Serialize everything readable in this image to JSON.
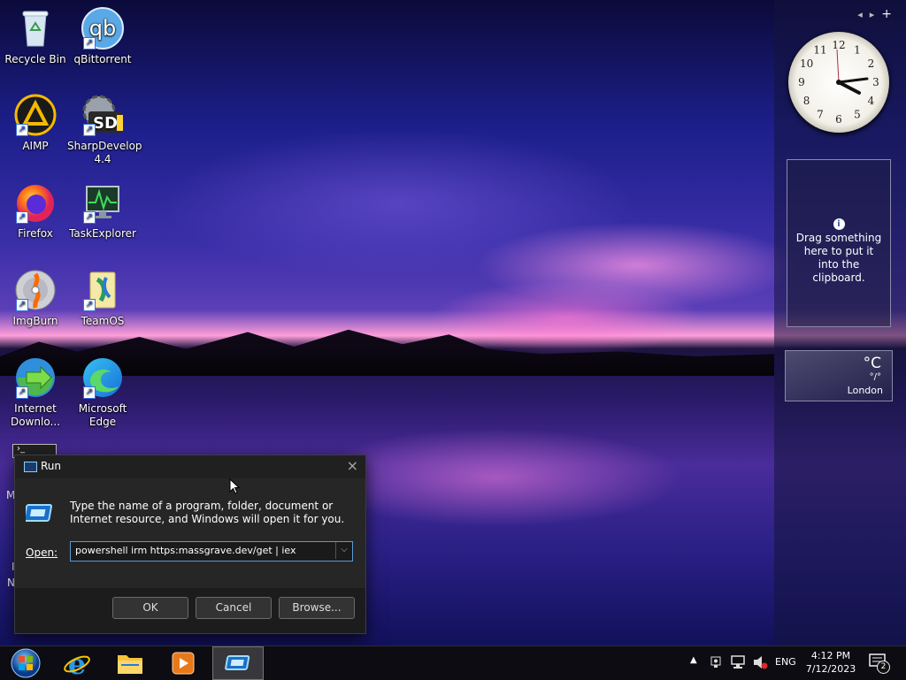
{
  "desktop_icons": [
    {
      "label": "Recycle Bin",
      "icon": "recycle-bin-icon",
      "shortcut": false
    },
    {
      "label": "qBittorrent",
      "icon": "qbittorrent-icon",
      "shortcut": true
    },
    {
      "label": "AIMP",
      "icon": "aimp-icon",
      "shortcut": true
    },
    {
      "label": "SharpDevelop 4.4",
      "icon": "sharpdevelop-icon",
      "shortcut": true
    },
    {
      "label": "Firefox",
      "icon": "firefox-icon",
      "shortcut": true
    },
    {
      "label": "TaskExplorer",
      "icon": "taskexplorer-icon",
      "shortcut": true
    },
    {
      "label": "ImgBurn",
      "icon": "imgburn-icon",
      "shortcut": true
    },
    {
      "label": "TeamOS",
      "icon": "teamos-icon",
      "shortcut": true
    },
    {
      "label": "Internet Downlo...",
      "icon": "internet-download-manager-icon",
      "shortcut": true
    },
    {
      "label": "Microsoft Edge",
      "icon": "edge-icon",
      "shortcut": true
    }
  ],
  "partial_icons": {
    "m_label": "M",
    "i_label": "I",
    "n_label": "N"
  },
  "gadgets": {
    "nav_prev": "◂",
    "nav_next": "▸",
    "add": "+",
    "clock_numbers": [
      "12",
      "1",
      "2",
      "3",
      "4",
      "5",
      "6",
      "7",
      "8",
      "9",
      "10",
      "11"
    ],
    "clipboard_text": "Drag something here to put it into the clipboard.",
    "weather_temp": "°C",
    "weather_range": "°/°",
    "weather_city": "London"
  },
  "run_dialog": {
    "title": "Run",
    "description": "Type the name of a program, folder, document or Internet resource, and Windows will open it for you.",
    "open_label": "Open:",
    "command_value": "powershell irm https:massgrave.dev/get | iex",
    "ok_label": "OK",
    "cancel_label": "Cancel",
    "browse_label": "Browse..."
  },
  "taskbar": {
    "pinned": [
      "start-orb-icon",
      "internet-explorer-icon",
      "file-explorer-icon",
      "media-player-icon",
      "run-app-icon"
    ],
    "tray_language": "ENG",
    "time": "4:12 PM",
    "date": "7/12/2023",
    "notification_count": "2"
  }
}
